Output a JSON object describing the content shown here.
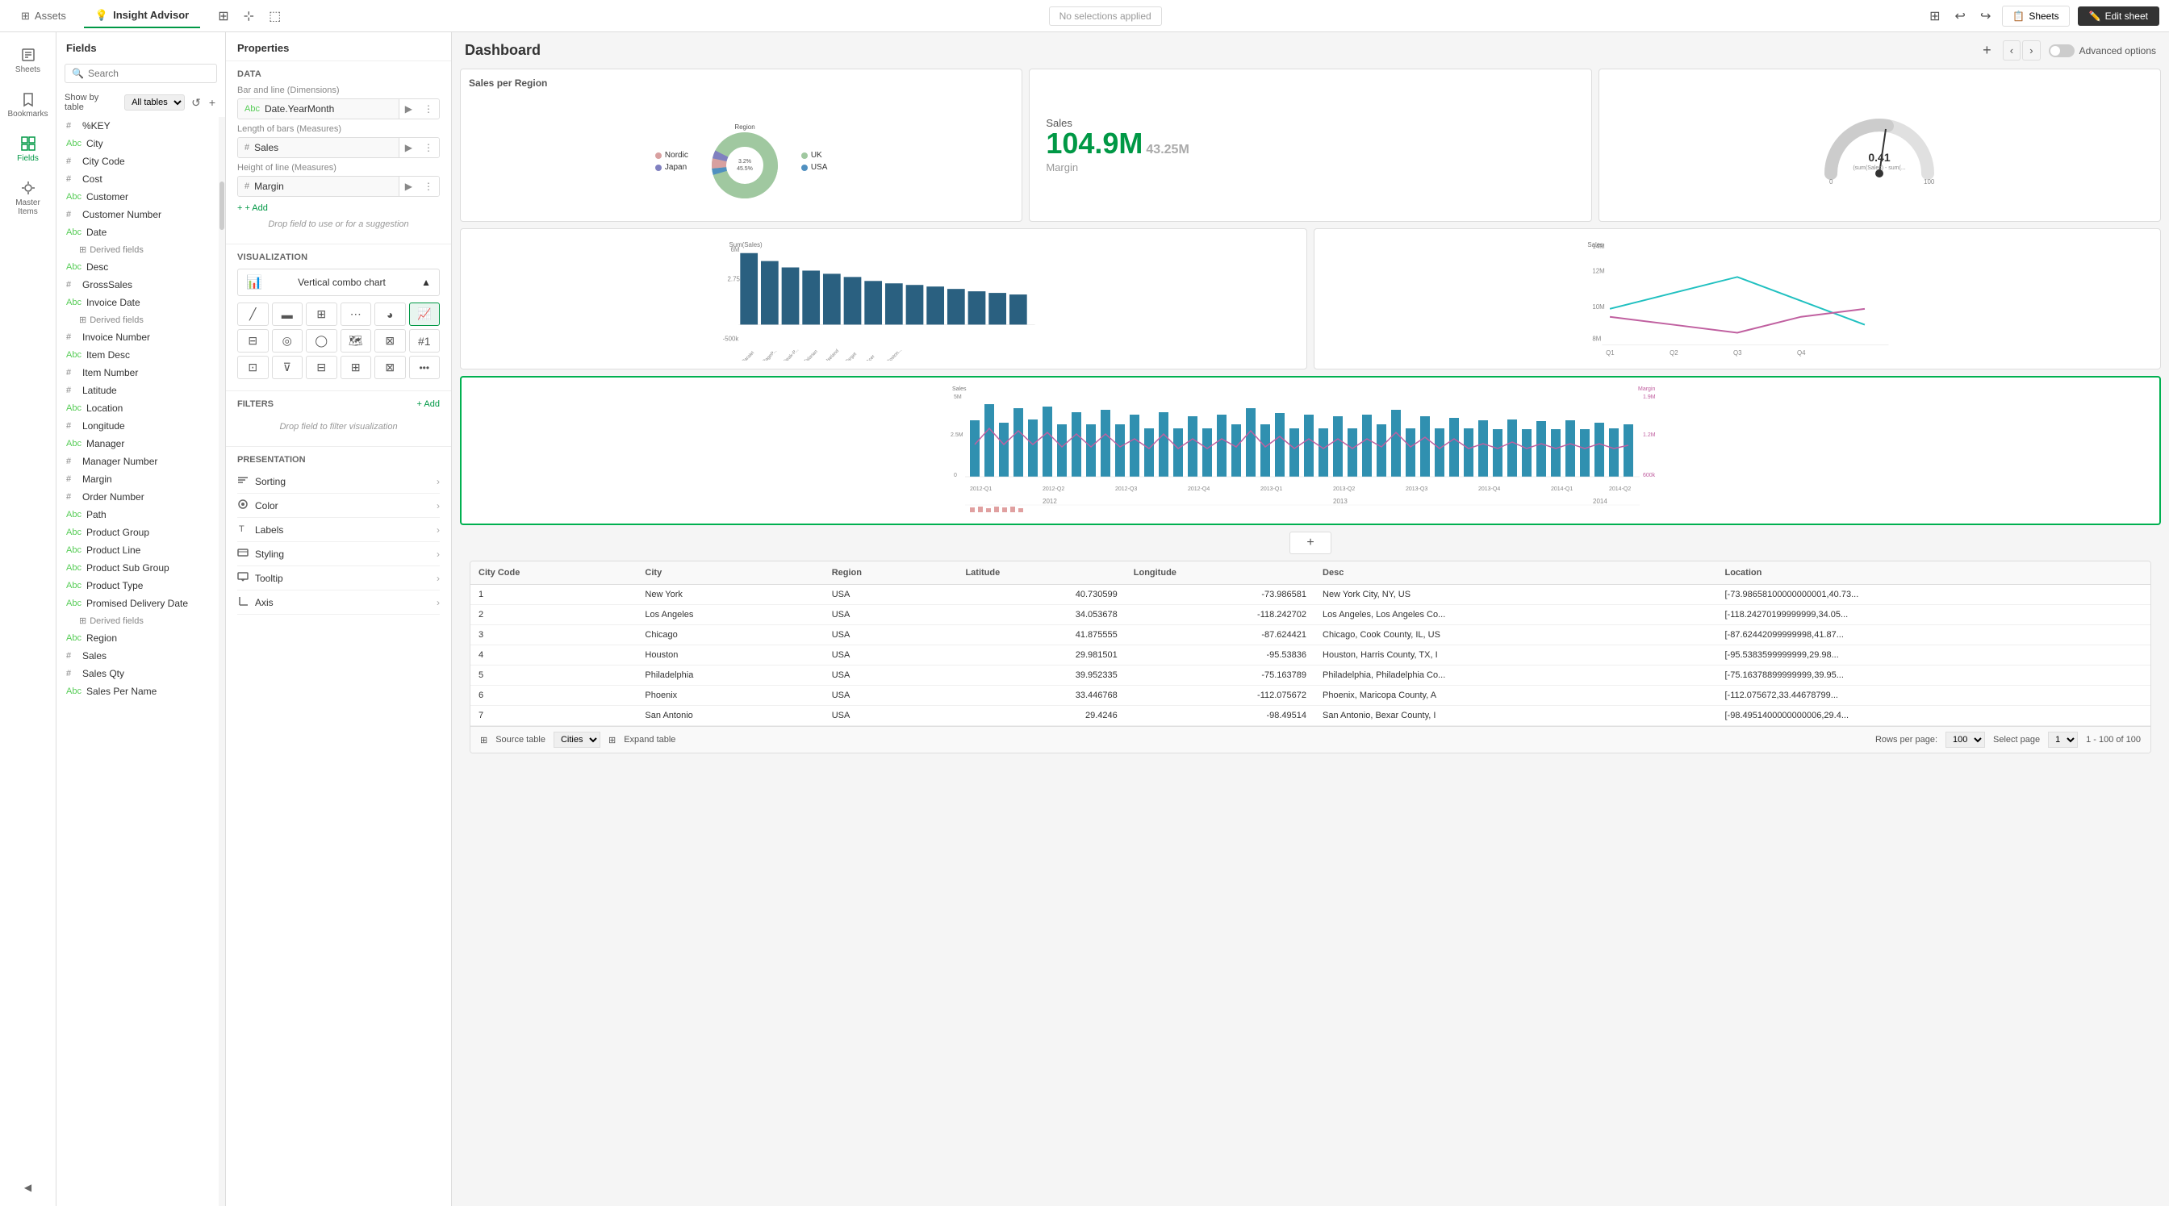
{
  "topbar": {
    "assets_label": "Assets",
    "insight_advisor_label": "Insight Advisor",
    "no_selections": "No selections applied",
    "sheets_label": "Sheets",
    "edit_sheet_label": "Edit sheet"
  },
  "sidebar": {
    "items": [
      {
        "id": "sheets",
        "label": "Sheets",
        "icon": "📄"
      },
      {
        "id": "bookmarks",
        "label": "Bookmarks",
        "icon": "🔖"
      },
      {
        "id": "fields",
        "label": "Fields",
        "icon": "⊞",
        "active": true
      },
      {
        "id": "master-items",
        "label": "Master Items",
        "icon": "⭐"
      }
    ],
    "collapse_label": "◀"
  },
  "fields_panel": {
    "title": "Fields",
    "search_placeholder": "Search",
    "show_by_label": "Show by table",
    "table_option": "All tables",
    "fields": [
      {
        "type": "#",
        "name": "%KEY"
      },
      {
        "type": "Abc",
        "name": "City"
      },
      {
        "type": "#",
        "name": "City Code"
      },
      {
        "type": "#",
        "name": "Cost"
      },
      {
        "type": "Abc",
        "name": "Customer"
      },
      {
        "type": "#",
        "name": "Customer Number"
      },
      {
        "type": "Abc",
        "name": "Date"
      },
      {
        "type": "⊞",
        "name": "Derived fields",
        "indent": true
      },
      {
        "type": "Abc",
        "name": "Desc"
      },
      {
        "type": "#",
        "name": "GrossSales"
      },
      {
        "type": "Abc",
        "name": "Invoice Date"
      },
      {
        "type": "⊞",
        "name": "Derived fields",
        "indent": true
      },
      {
        "type": "#",
        "name": "Invoice Number"
      },
      {
        "type": "Abc",
        "name": "Item Desc"
      },
      {
        "type": "#",
        "name": "Item Number"
      },
      {
        "type": "#",
        "name": "Latitude"
      },
      {
        "type": "Abc",
        "name": "Location"
      },
      {
        "type": "#",
        "name": "Longitude"
      },
      {
        "type": "Abc",
        "name": "Manager"
      },
      {
        "type": "#",
        "name": "Manager Number"
      },
      {
        "type": "#",
        "name": "Margin"
      },
      {
        "type": "#",
        "name": "Order Number"
      },
      {
        "type": "Abc",
        "name": "Path"
      },
      {
        "type": "Abc",
        "name": "Product Group"
      },
      {
        "type": "Abc",
        "name": "Product Line"
      },
      {
        "type": "Abc",
        "name": "Product Sub Group"
      },
      {
        "type": "Abc",
        "name": "Product Type"
      },
      {
        "type": "Abc",
        "name": "Promised Delivery Date"
      },
      {
        "type": "⊞",
        "name": "Derived fields",
        "indent": true
      },
      {
        "type": "Abc",
        "name": "Region"
      },
      {
        "type": "#",
        "name": "Sales"
      },
      {
        "type": "#",
        "name": "Sales Qty"
      },
      {
        "type": "Abc",
        "name": "Sales Per Name"
      }
    ]
  },
  "properties": {
    "title": "Properties",
    "data_section": "Data",
    "bar_line_dims": "Bar and line (Dimensions)",
    "dim_field": "Date.YearMonth",
    "length_bars": "Length of bars (Measures)",
    "measure_sales": "Sales",
    "height_line": "Height of line (Measures)",
    "measure_margin": "Margin",
    "add_label": "+ Add",
    "drop_hint": "Drop field to use or for a suggestion",
    "visualization_label": "Visualization",
    "viz_current": "Vertical combo chart",
    "filters_label": "Filters",
    "add_filter_label": "+ Add",
    "drop_filter_hint": "Drop field to filter visualization",
    "presentation_label": "Presentation",
    "pres_items": [
      {
        "icon": "≡",
        "label": "Sorting"
      },
      {
        "icon": "●",
        "label": "Color"
      },
      {
        "icon": "T",
        "label": "Labels"
      },
      {
        "icon": "≡",
        "label": "Styling"
      },
      {
        "icon": "⬜",
        "label": "Tooltip"
      },
      {
        "icon": "⊢",
        "label": "Axis"
      }
    ]
  },
  "dashboard": {
    "title": "Dashboard",
    "advanced_options": "Advanced options",
    "charts": {
      "sales_region": {
        "title": "Sales per Region",
        "legend_label": "Region",
        "segments": [
          {
            "label": "Nordic",
            "color": "#e8a0a0",
            "pct": 5
          },
          {
            "label": "Japan",
            "color": "#c0c0e0",
            "pct": 4
          },
          {
            "label": "UK",
            "color": "#a0c0a0",
            "pct": 45.5
          },
          {
            "label": "USA",
            "color": "#5090c0",
            "pct": 3.2
          }
        ]
      },
      "sales_kpi": {
        "label": "Sales",
        "value": "104.9M",
        "sub_value": "43.25M",
        "sub_label": "Margin"
      },
      "gauge": {
        "value": "0.41",
        "sub_label": "(sum(Sales) - sum(...)",
        "min": "0",
        "max": "100"
      }
    },
    "table": {
      "source_label": "Source table",
      "source_value": "Cities",
      "expand_label": "Expand table",
      "rows_per_page_label": "Rows per page:",
      "rows_per_page": "100",
      "select_page_label": "Select page",
      "select_page": "1",
      "page_info": "1 - 100 of 100",
      "columns": [
        "City Code",
        "City",
        "Region",
        "Latitude",
        "Longitude",
        "Desc",
        "Location"
      ],
      "rows": [
        {
          "city_code": "1",
          "city": "New York",
          "region": "USA",
          "latitude": "40.730599",
          "longitude": "-73.986581",
          "desc": "New York City, NY, US",
          "location": "[-73.98658100000000001,40.73..."
        },
        {
          "city_code": "2",
          "city": "Los Angeles",
          "region": "USA",
          "latitude": "34.053678",
          "longitude": "-118.242702",
          "desc": "Los Angeles, Los Angeles Co...",
          "location": "[-118.24270199999999,34.05..."
        },
        {
          "city_code": "3",
          "city": "Chicago",
          "region": "USA",
          "latitude": "41.875555",
          "longitude": "-87.624421",
          "desc": "Chicago, Cook County, IL, US",
          "location": "[-87.62442099999998,41.87..."
        },
        {
          "city_code": "4",
          "city": "Houston",
          "region": "USA",
          "latitude": "29.981501",
          "longitude": "-95.53836",
          "desc": "Houston, Harris County, TX, I",
          "location": "[-95.5383599999999,29.98..."
        },
        {
          "city_code": "5",
          "city": "Philadelphia",
          "region": "USA",
          "latitude": "39.952335",
          "longitude": "-75.163789",
          "desc": "Philadelphia, Philadelphia Co...",
          "location": "[-75.16378899999999,39.95..."
        },
        {
          "city_code": "6",
          "city": "Phoenix",
          "region": "USA",
          "latitude": "33.446768",
          "longitude": "-112.075672",
          "desc": "Phoenix, Maricopa County, A",
          "location": "[-112.075672,33.44678799..."
        },
        {
          "city_code": "7",
          "city": "San Antonio",
          "region": "USA",
          "latitude": "29.4246",
          "longitude": "-98.49514",
          "desc": "San Antonio, Bexar County, I",
          "location": "[-98.4951400000000006,29.4..."
        }
      ]
    }
  }
}
